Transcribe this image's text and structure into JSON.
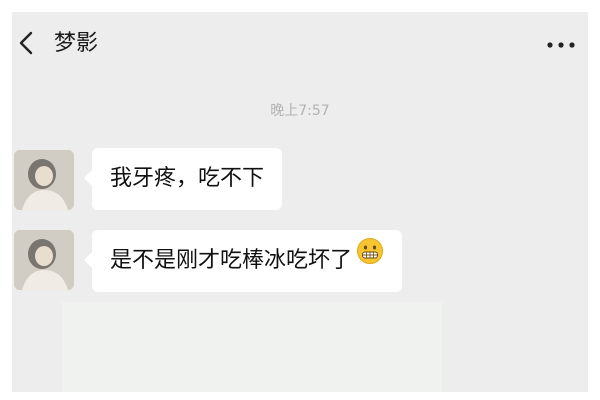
{
  "header": {
    "back_icon": "chevron-left-icon",
    "title": "梦影",
    "more_icon": "more-dots-icon"
  },
  "chat": {
    "timestamp": "晚上7:57",
    "messages": [
      {
        "sender": "梦影",
        "avatar_icon": "avatar-photo",
        "text": "我牙疼，吃不下",
        "emoji": ""
      },
      {
        "sender": "梦影",
        "avatar_icon": "avatar-photo",
        "text": "是不是刚才吃棒冰吃坏了",
        "emoji": "grimace-emoji"
      }
    ]
  },
  "colors": {
    "background": "#ededed",
    "bubble": "#ffffff",
    "timestamp": "#b2b2b2",
    "text": "#111111"
  }
}
